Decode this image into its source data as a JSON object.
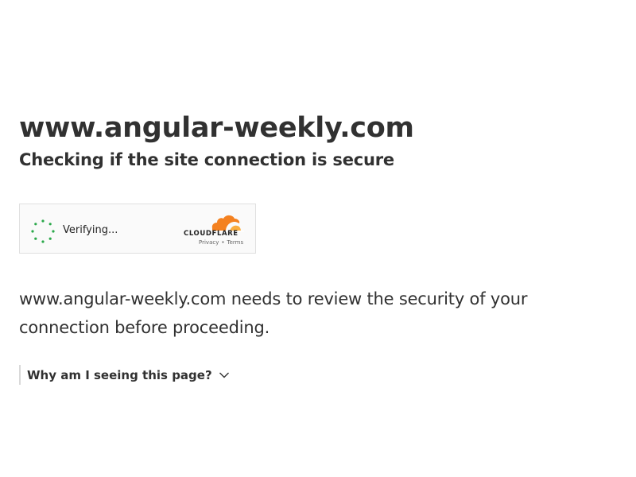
{
  "page": {
    "title": "www.angular-weekly.com",
    "subtitle": "Checking if the site connection is secure"
  },
  "challenge_widget": {
    "status_text": "Verifying...",
    "brand": "CLOUDFLARE",
    "privacy_label": "Privacy",
    "separator": "•",
    "terms_label": "Terms",
    "spinner_color": "#2aa84a",
    "brand_color": "#f48120"
  },
  "description": "www.angular-weekly.com needs to review the security of your connection before proceeding.",
  "details": {
    "label": "Why am I seeing this page?"
  }
}
